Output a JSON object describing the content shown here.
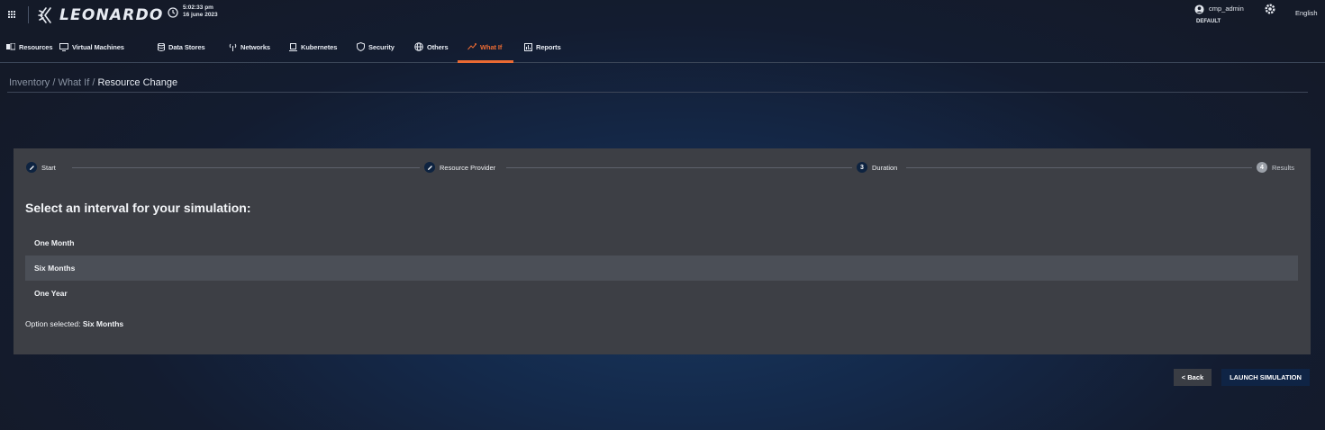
{
  "header": {
    "brand": "LEONARDO",
    "time": "5:02:33 pm",
    "date": "16 june 2023",
    "user": "cmp_admin",
    "tenant": "DEFAULT",
    "language": "English"
  },
  "nav": {
    "items": [
      {
        "label": "Resources",
        "icon": "resources-icon"
      },
      {
        "label": "Virtual Machines",
        "icon": "monitor-icon"
      },
      {
        "label": "Data Stores",
        "icon": "database-icon"
      },
      {
        "label": "Networks",
        "icon": "antenna-icon"
      },
      {
        "label": "Kubernetes",
        "icon": "kubernetes-icon"
      },
      {
        "label": "Security",
        "icon": "shield-icon"
      },
      {
        "label": "Others",
        "icon": "globe-icon"
      },
      {
        "label": "What If",
        "icon": "what-if-icon"
      },
      {
        "label": "Reports",
        "icon": "report-icon"
      }
    ],
    "active": "What If",
    "active_color": "#ea6a33"
  },
  "breadcrumb": {
    "items": [
      "Inventory",
      "What If"
    ],
    "separator": "/",
    "current": "Resource Change"
  },
  "stepper": {
    "steps": [
      {
        "label": "Start",
        "state": "done",
        "marker": ""
      },
      {
        "label": "Resource Provider",
        "state": "done",
        "marker": ""
      },
      {
        "label": "Duration",
        "state": "current",
        "marker": "3"
      },
      {
        "label": "Results",
        "state": "pending",
        "marker": "4"
      }
    ]
  },
  "form": {
    "question": "Select an interval for your simulation:",
    "options": [
      "One Month",
      "Six Months",
      "One Year"
    ],
    "selected": "Six Months",
    "selected_prefix": "Option selected:",
    "selected_value": "Six Months"
  },
  "actions": {
    "back_label": "< Back",
    "launch_label": "LAUNCH SIMULATION"
  }
}
